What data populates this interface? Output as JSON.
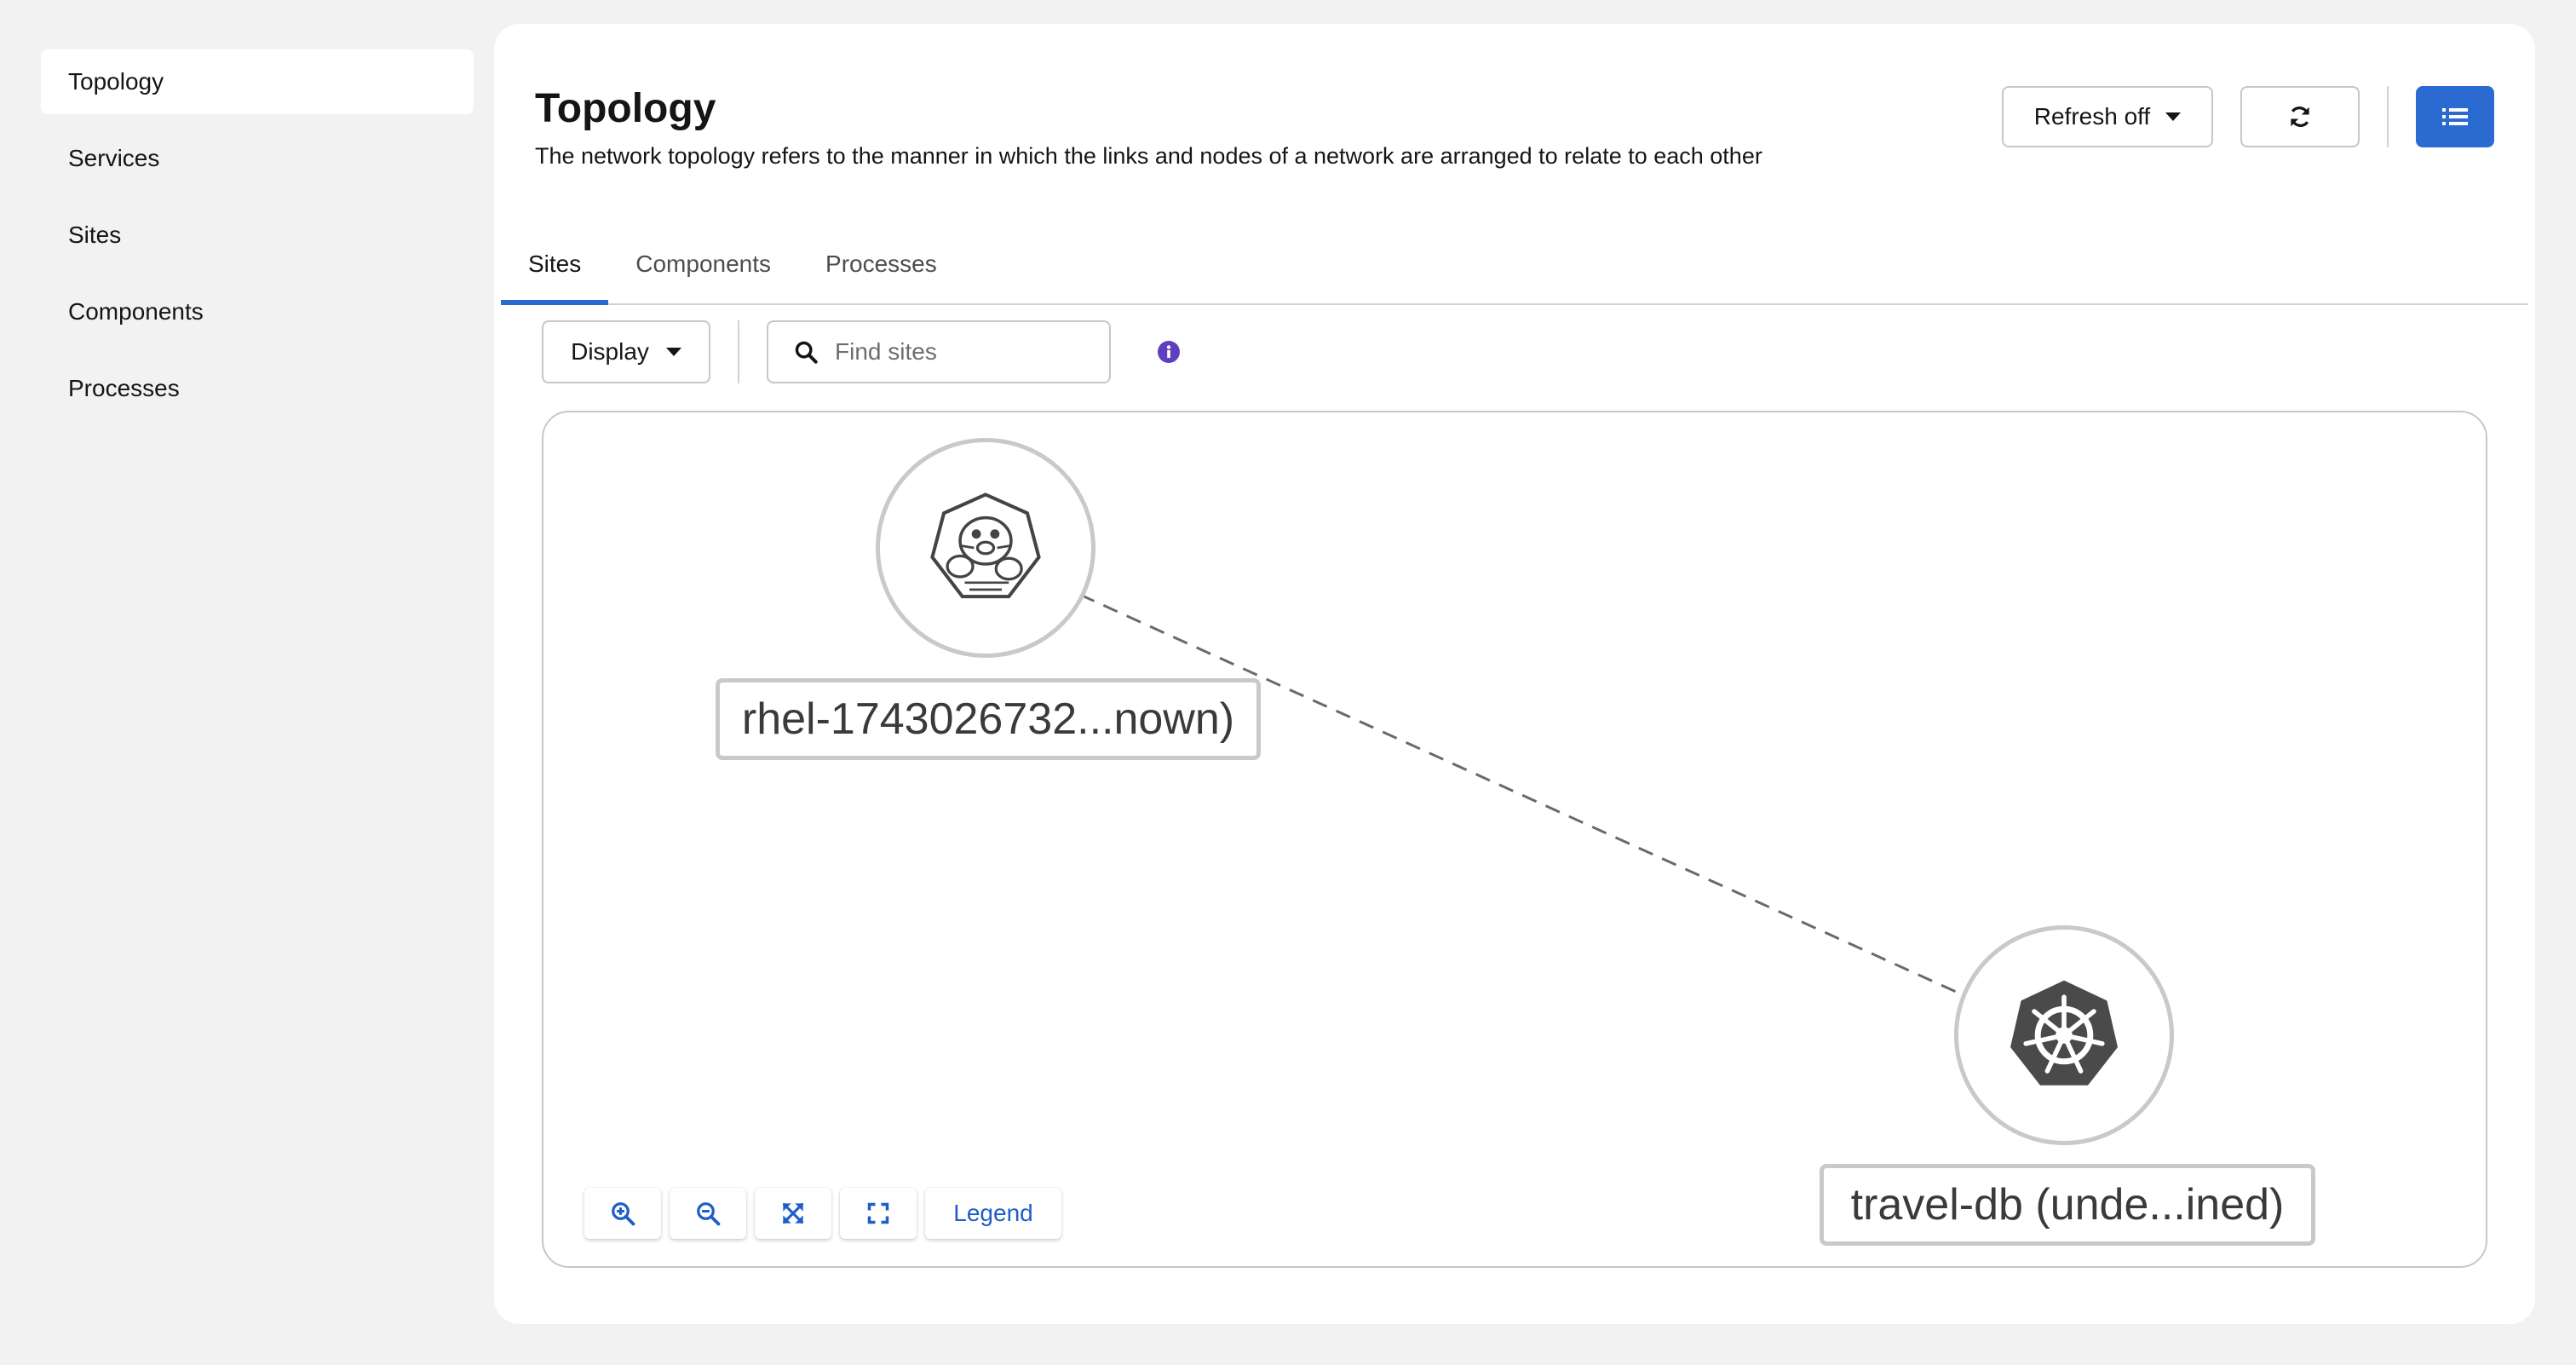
{
  "sidebar": {
    "items": [
      {
        "label": "Topology"
      },
      {
        "label": "Services"
      },
      {
        "label": "Sites"
      },
      {
        "label": "Components"
      },
      {
        "label": "Processes"
      }
    ]
  },
  "header": {
    "title": "Topology",
    "description": "The network topology refers to the manner in which the links and nodes of a network are arranged to relate to each other",
    "refresh_select": "Refresh off"
  },
  "tabs": [
    {
      "label": "Sites"
    },
    {
      "label": "Components"
    },
    {
      "label": "Processes"
    }
  ],
  "toolbar": {
    "display_select": "Display",
    "search_placeholder": "Find sites"
  },
  "topology": {
    "nodes": [
      {
        "label": "rhel-1743026732...nown)",
        "icon": "podman-seal-icon"
      },
      {
        "label": "travel-db (unde...ined)",
        "icon": "kubernetes-icon"
      }
    ],
    "edges": [
      {
        "from": 0,
        "to": 1,
        "style": "dashed"
      }
    ]
  },
  "controls": {
    "legend_label": "Legend"
  },
  "colors": {
    "primary": "#2b6bd1",
    "info": "#5e40be",
    "border": "#c9c9c9",
    "background": "#f2f2f2"
  }
}
